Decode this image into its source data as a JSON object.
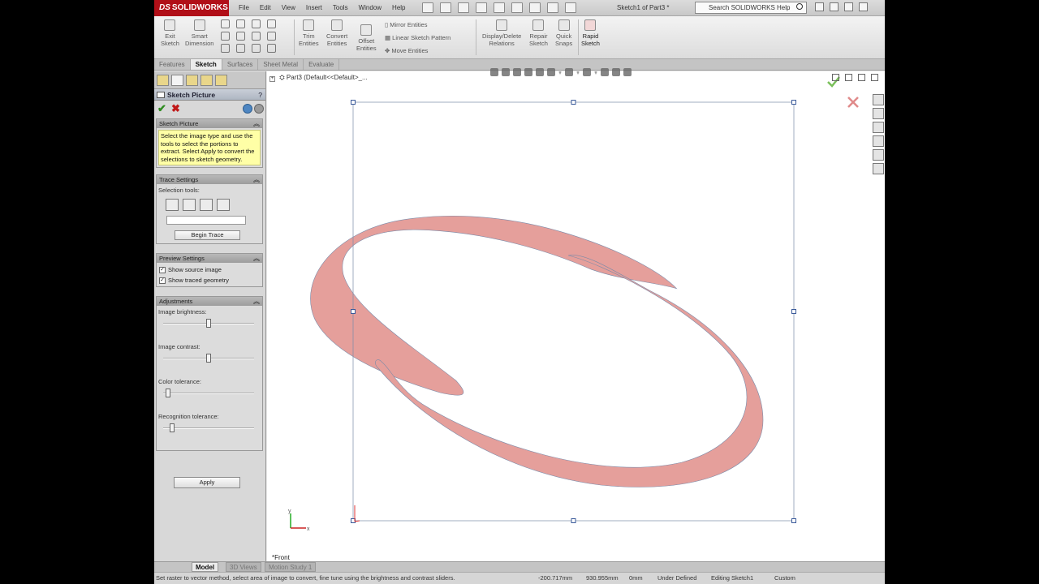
{
  "app": {
    "brand": "SOLIDWORKS",
    "brand_prefix": "DS",
    "document_title": "Sketch1 of Part3 *",
    "help_search_placeholder": "Search SOLIDWORKS Help"
  },
  "menus": [
    "File",
    "Edit",
    "View",
    "Insert",
    "Tools",
    "Window",
    "Help"
  ],
  "ribbon": {
    "exit_sketch": [
      "Exit",
      "Sketch"
    ],
    "smart_dimension": [
      "Smart",
      "Dimension"
    ],
    "trim_entities": [
      "Trim",
      "Entities"
    ],
    "convert_entities": [
      "Convert",
      "Entities"
    ],
    "offset_entities": [
      "Offset",
      "Entities"
    ],
    "mirror_entities": "Mirror Entities",
    "linear_pattern": "Linear Sketch Pattern",
    "move_entities": "Move Entities",
    "display_relations": [
      "Display/Delete",
      "Relations"
    ],
    "repair_sketch": [
      "Repair",
      "Sketch"
    ],
    "quick_snaps": [
      "Quick",
      "Snaps"
    ],
    "rapid_sketch": [
      "Rapid",
      "Sketch"
    ]
  },
  "tabs": [
    "Features",
    "Sketch",
    "Surfaces",
    "Sheet Metal",
    "Evaluate"
  ],
  "active_tab": "Sketch",
  "property_manager": {
    "title": "Sketch Picture",
    "help_mark": "?",
    "ok_glyph": "✔",
    "cancel_glyph": "✖",
    "section_sketch_picture": "Sketch Picture",
    "message": "Select the image type and use the tools to select the portions to extract. Select Apply to convert the selections to sketch geometry.",
    "section_trace": "Trace Settings",
    "selection_tools_label": "Selection tools:",
    "begin_trace": "Begin Trace",
    "section_preview": "Preview Settings",
    "show_source_image": "Show source image",
    "show_traced_geometry": "Show traced geometry",
    "section_adjustments": "Adjustments",
    "adjustments": [
      {
        "label": "Image brightness:",
        "value": 0.5
      },
      {
        "label": "Image contrast:",
        "value": 0.5
      },
      {
        "label": "Color tolerance:",
        "value": 0.05
      },
      {
        "label": "Recognition tolerance:",
        "value": 0.1
      }
    ],
    "apply": "Apply"
  },
  "feature_tree": {
    "expand_glyph": "+",
    "part": "Part3",
    "config": "(Default<<Default>_..."
  },
  "sketch": {
    "fill_color": "#e59f9b",
    "outline_color": "#7a8aa8",
    "handle_color": "#3a5a9a"
  },
  "graphics": {
    "view_name": "*Front",
    "confirm_ok_color": "#7ac05a",
    "confirm_cancel_color": "#e08a8a"
  },
  "bottom_tabs": [
    "Model",
    "3D Views",
    "Motion Study 1"
  ],
  "status": {
    "hint": "Set raster to vector method, select area of image to convert, fine tune using the brightness and contrast sliders.",
    "x": "-200.717mm",
    "y": "930.955mm",
    "z": "0mm",
    "state": "Under Defined",
    "editing": "Editing Sketch1",
    "units": "Custom"
  }
}
